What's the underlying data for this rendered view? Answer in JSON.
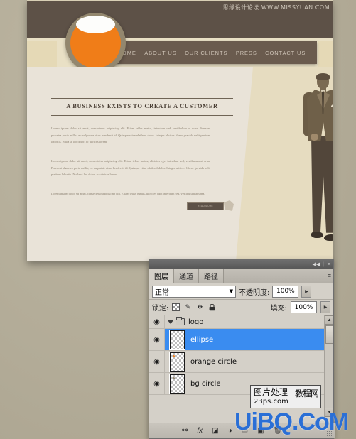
{
  "watermarks": {
    "top_right": "思缘设计论坛  WWW.MISSYUAN.COM",
    "bottom_big": "UiBQ.CoM",
    "box_line1": "图片处理",
    "box_line2": "23ps.com",
    "box_cn": "教程网"
  },
  "mockup": {
    "nav": [
      {
        "label": "HOME"
      },
      {
        "label": "ABOUT US"
      },
      {
        "label": "OUR CLIENTS"
      },
      {
        "label": "PRESS"
      },
      {
        "label": "CONTACT US"
      }
    ],
    "headline": "A BUSINESS EXISTS TO CREATE A CUSTOMER",
    "paragraphs": [
      "Lorem ipsum dolor sit amet, consectetur adipiscing elit. Etiam tellus metus, interdum sed, vestibulum at urna. Praesent pharetra porta nullis, eu vulputate risus hendrerit id. Quisque vitae eleifend dolor. Integer ultrices libero gravida velit pretium lobortis. Nulla ut leo dolor, ac ultrices lorem.",
      "Lorem ipsum dolor sit amet, consectetur adipiscing elit. Etiam tellus metus, ultricies eget interdum sed, vestibulum at urna. Praesent pharetra porta nullis, eu vulputate risus hendrerit id. Quisque vitae eleifend dolor. Integer ultrices libero gravida velit pretium lobortis. Nulla ut leo dolor, ac ultrices lorem.",
      "Lorem ipsum dolor sit amet, consectetur adipiscing elit. Etiam tellus metus, ultricies eget interdum sed, vestibulum at urna."
    ],
    "read_more": "READ MORE",
    "illustration_alt": "vintage-businessman",
    "colors": {
      "header": "#5d5147",
      "nav": "#6a5b4e",
      "ribbon": "#e5d9b6",
      "content": "#e9e3d8",
      "logo_ring": "#93876e",
      "logo_orange": "#f07d18",
      "logo_ellipse": "#fdfdfb"
    }
  },
  "panel": {
    "titlebar": {
      "collapse": "◀◀",
      "separator": "|",
      "close": "✕"
    },
    "tabs": [
      {
        "label": "图层",
        "active": true
      },
      {
        "label": "通道",
        "active": false
      },
      {
        "label": "路径",
        "active": false
      }
    ],
    "menu_icon": "≡",
    "blend_mode": {
      "value": "正常",
      "arrow": "▼"
    },
    "opacity": {
      "label": "不透明度:",
      "value": "100%",
      "arrow": "▶"
    },
    "lock": {
      "label": "锁定:",
      "icons": [
        "transparent-pixels",
        "brush",
        "move",
        "lock"
      ],
      "brush_glyph": "✎",
      "move_glyph": "✥",
      "lock_glyph": "🔒"
    },
    "fill": {
      "label": "填充:",
      "value": "100%",
      "arrow": "▶"
    },
    "group": {
      "name": "logo",
      "expanded": true,
      "visible": true
    },
    "layers": [
      {
        "name": "ellipse",
        "visible": true,
        "selected": true,
        "dot": ""
      },
      {
        "name": "orange circle",
        "visible": true,
        "selected": false,
        "dot": "#f07d18"
      },
      {
        "name": "bg circle",
        "visible": true,
        "selected": false,
        "dot": "#93876e"
      }
    ],
    "scrollbar": {
      "up": "▲",
      "down": "▼"
    },
    "footer_icons": [
      "link",
      "fx",
      "mask",
      "adjustment",
      "group",
      "new-layer",
      "delete"
    ],
    "eye_glyph": "◉"
  }
}
